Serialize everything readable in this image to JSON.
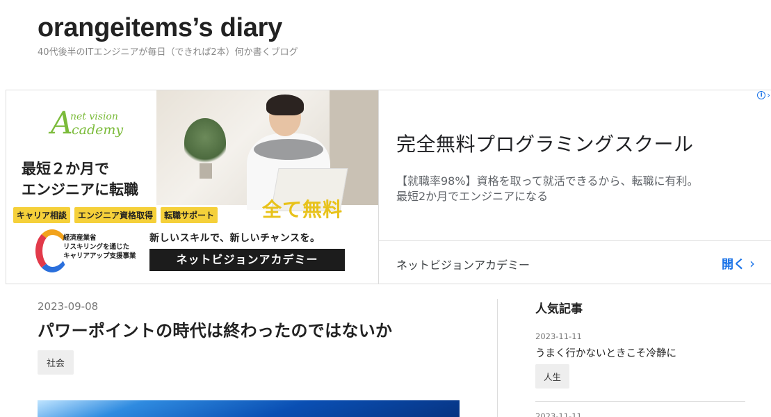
{
  "blog": {
    "title": "orangeitems’s diary",
    "description": "40代後半のITエンジニアが毎日（できれば2本）何か書くブログ"
  },
  "ad": {
    "logo_letter": "A",
    "logo_line1": "net vision",
    "logo_line2": "cademy",
    "headline_line1": "最短２か月で",
    "headline_line2": "エンジニアに転職",
    "chips": [
      "キャリア相談",
      "エンジニア資格取得",
      "転職サポート"
    ],
    "free_text": "全て無料",
    "ministry_line1": "経済産業省",
    "ministry_line2": "リスキリングを通じた",
    "ministry_line3": "キャリアアップ支援事業",
    "tagline": "新しいスキルで、新しいチャンスを。",
    "cta_box": "ネットビジョンアカデミー",
    "text_title": "完全無料プログラミングスクール",
    "text_desc_line1": "【就職率98%】資格を取って就活できるから、転職に有利。",
    "text_desc_line2": "最短2か月でエンジニアになる",
    "advertiser": "ネットビジョンアカデミー",
    "open_label": "開く",
    "open_chevron": "›",
    "info_glyph": "i",
    "info_chevron": "›",
    "accent_color": "#1a73e8"
  },
  "post": {
    "date": "2023-09-08",
    "title": "パワーポイントの時代は終わったのではないか",
    "tag": "社会"
  },
  "sidebar": {
    "heading": "人気記事",
    "items": [
      {
        "date": "2023-11-11",
        "title": "うまく行かないときこそ冷静に",
        "tag": "人生"
      },
      {
        "date": "2023-11-11"
      }
    ]
  }
}
